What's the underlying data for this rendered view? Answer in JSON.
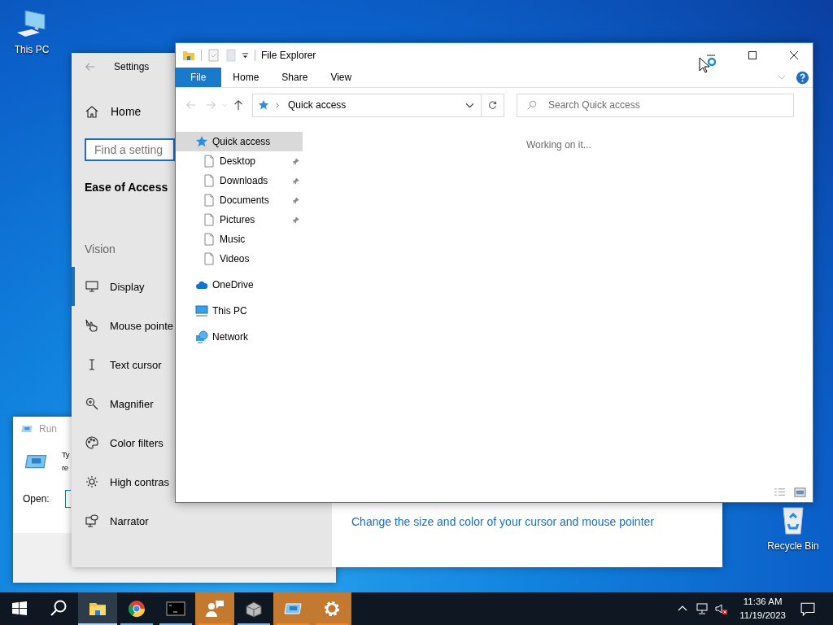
{
  "desktop_icons": [
    {
      "label": "This PC",
      "kind": "computer"
    },
    {
      "label": "Recycle Bin",
      "kind": "recycle"
    }
  ],
  "run_dialog": {
    "title": "Run",
    "description_lines": [
      "Ty",
      "re"
    ],
    "open_label": "Open:"
  },
  "settings": {
    "title": "Settings",
    "home": "Home",
    "search": {
      "placeholder": "Find a setting"
    },
    "section": "Ease of Access",
    "group": "Vision",
    "items": [
      {
        "label": "Display",
        "kind": "display",
        "selected": true
      },
      {
        "label": "Mouse pointe",
        "kind": "mouse",
        "selected": false
      },
      {
        "label": "Text cursor",
        "kind": "text-cursor",
        "selected": false
      },
      {
        "label": "Magnifier",
        "kind": "magnifier",
        "selected": false
      },
      {
        "label": "Color filters",
        "kind": "palette",
        "selected": false
      },
      {
        "label": "High contras",
        "kind": "sun",
        "selected": false
      },
      {
        "label": "Narrator",
        "kind": "narrator",
        "selected": false
      }
    ],
    "link": "Change the size and color of your cursor and mouse pointer"
  },
  "explorer": {
    "title": "File Explorer",
    "tabs": [
      {
        "label": "File",
        "selected": true
      },
      {
        "label": "Home",
        "selected": false
      },
      {
        "label": "Share",
        "selected": false
      },
      {
        "label": "View",
        "selected": false
      }
    ],
    "address": "Quick access",
    "search": {
      "placeholder": "Search Quick access"
    },
    "nav": [
      {
        "label": "Quick access",
        "kind": "star",
        "selected": true,
        "children": [
          {
            "label": "Desktop",
            "kind": "doc",
            "pinned": true,
            "selected": false
          },
          {
            "label": "Downloads",
            "kind": "doc",
            "pinned": true,
            "selected": false
          },
          {
            "label": "Documents",
            "kind": "doc",
            "pinned": true,
            "selected": false
          },
          {
            "label": "Pictures",
            "kind": "doc",
            "pinned": true,
            "selected": false
          },
          {
            "label": "Music",
            "kind": "doc",
            "pinned": false,
            "selected": false
          },
          {
            "label": "Videos",
            "kind": "doc",
            "pinned": false,
            "selected": false
          }
        ]
      },
      {
        "label": "OneDrive",
        "kind": "cloud",
        "selected": false
      },
      {
        "label": "This PC",
        "kind": "pc",
        "selected": false
      },
      {
        "label": "Network",
        "kind": "network",
        "selected": false
      }
    ],
    "status": "Working on it..."
  },
  "taskbar": {
    "items": [
      {
        "kind": "explorer",
        "selected": true,
        "flashing": false
      },
      {
        "kind": "chrome",
        "selected": false,
        "flashing": false
      },
      {
        "kind": "cmd",
        "selected": false,
        "flashing": false
      },
      {
        "kind": "people",
        "selected": false,
        "flashing": true
      },
      {
        "kind": "package",
        "selected": false,
        "flashing": false
      },
      {
        "kind": "run",
        "selected": false,
        "flashing": true
      },
      {
        "kind": "settings",
        "selected": false,
        "flashing": true
      }
    ],
    "time": "11:36 AM",
    "date": "11/19/2023"
  }
}
